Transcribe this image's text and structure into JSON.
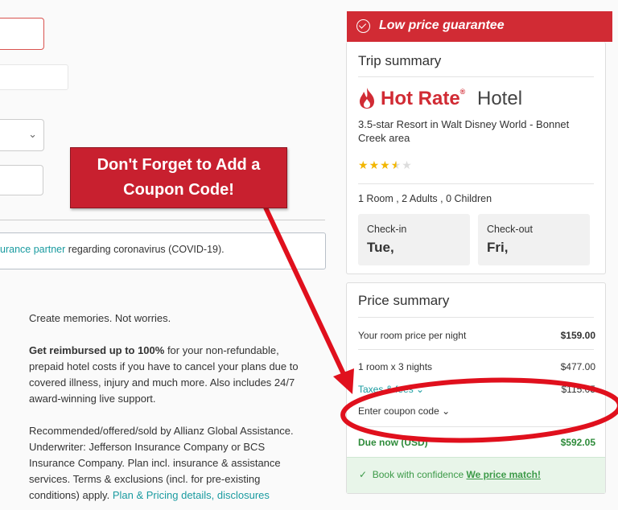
{
  "covid_notice": {
    "link": "urance partner",
    "text": " regarding coronavirus (COVID-19)."
  },
  "insurance": {
    "tagline": "Create memories. Not worries.",
    "reimburse_bold": "Get reimbursed up to 100%",
    "reimburse_text": " for your non-refundable, prepaid hotel costs if you have to cancel your plans due to covered illness, injury and much more. Also includes 24/7 award-winning live support.",
    "disclosure_text": "Recommended/offered/sold by Allianz Global Assistance. Underwriter: Jefferson Insurance Company or BCS Insurance Company. Plan incl. insurance & assistance services. Terms & exclusions (incl. for pre-existing conditions) apply. ",
    "disclosure_link": "Plan & Pricing details, disclosures"
  },
  "banner": {
    "text": "Low price guarantee",
    "color": "#d12b34"
  },
  "trip_summary": {
    "title": "Trip summary",
    "brand_hot_rate": "Hot Rate",
    "brand_reg": "®",
    "brand_hotel": "Hotel",
    "description": "3.5-star Resort in Walt Disney World - Bonnet Creek area",
    "star_rating": 3.5,
    "occupancy": "1 Room , 2 Adults , 0 Children",
    "checkin_label": "Check-in",
    "checkin_value": "Tue,",
    "checkout_label": "Check-out",
    "checkout_value": "Fri,"
  },
  "price_summary": {
    "title": "Price summary",
    "room_price_label": "Your room price per night",
    "room_price_value": "$159.00",
    "nights_label": "1 room x 3 nights",
    "nights_value": "$477.00",
    "taxes_label": "Taxes & fees",
    "taxes_value": "$115.05",
    "coupon_label": "Enter coupon code",
    "due_label": "Due now (USD)",
    "due_value": "$592.05",
    "confidence_text": "Book with confidence ",
    "confidence_link": "We price match!"
  },
  "callout": {
    "line1": "Don't Forget to Add a",
    "line2": "Coupon Code!",
    "color": "#c8202f"
  }
}
